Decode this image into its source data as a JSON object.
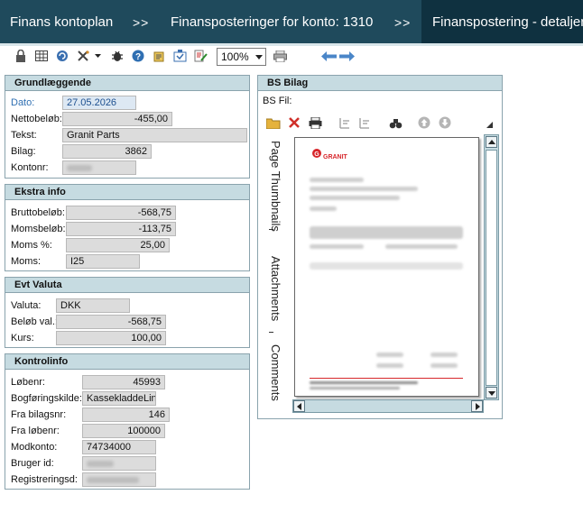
{
  "breadcrumb": {
    "items": [
      "Finans kontoplan",
      "Finansposteringer for konto: 1310",
      "Finanspostering - detaljer"
    ],
    "separator": ">>"
  },
  "toolbar": {
    "icons": [
      "lock-icon",
      "grid-icon",
      "refresh-icon",
      "tools-icon",
      "dropdown-caret-icon",
      "bug-icon",
      "help-icon",
      "import-icon",
      "export-icon",
      "edit-icon"
    ],
    "zoom": "100%",
    "print_icon": "printer-icon",
    "nav_icons": [
      "arrow-left-icon",
      "arrow-right-icon"
    ]
  },
  "grund": {
    "title": "Grundlæggende",
    "dato_label": "Dato:",
    "dato": "27.05.2026",
    "netto_label": "Nettobeløb:",
    "netto": "-455,00",
    "tekst_label": "Tekst:",
    "tekst": "Granit Parts",
    "bilag_label": "Bilag:",
    "bilag": "3862",
    "konto_label": "Kontonr:"
  },
  "ekstra": {
    "title": "Ekstra info",
    "brutto_label": "Bruttobeløb:",
    "brutto": "-568,75",
    "moms_beloeb_label": "Momsbeløb:",
    "moms_beloeb": "-113,75",
    "moms_pct_label": "Moms %:",
    "moms_pct": "25,00",
    "moms_label": "Moms:",
    "moms": "I25"
  },
  "valuta": {
    "title": "Evt Valuta",
    "valuta_label": "Valuta:",
    "valuta": "DKK",
    "beloeb_label": "Beløb val.:",
    "beloeb": "-568,75",
    "kurs_label": "Kurs:",
    "kurs": "100,00"
  },
  "kontrol": {
    "title": "Kontrolinfo",
    "loebenr_label": "Løbenr:",
    "loebenr": "45993",
    "kilde_label": "Bogføringskilde:",
    "kilde": "KassekladdeLinj",
    "bilagsnr_label": "Fra bilagsnr:",
    "bilagsnr": "146",
    "fra_loebenr_label": "Fra løbenr:",
    "fra_loebenr": "100000",
    "modkonto_label": "Modkonto:",
    "modkonto": "74734000",
    "bruger_label": "Bruger id:",
    "reg_label": "Registreringsd:"
  },
  "bs": {
    "title": "BS Bilag",
    "fil_label": "BS Fil:",
    "tabs": [
      "Page Thumbnails",
      "Attachments",
      "Comments"
    ],
    "logo": "GRANIT"
  },
  "colors": {
    "crumb_bg": "#1f4a5c",
    "crumb_active_bg": "#0f3140",
    "group_header": "#c6dbe1",
    "field_bg": "#dcdcdc",
    "date_color": "#2f6fb2",
    "logo_red": "#d7262b"
  }
}
